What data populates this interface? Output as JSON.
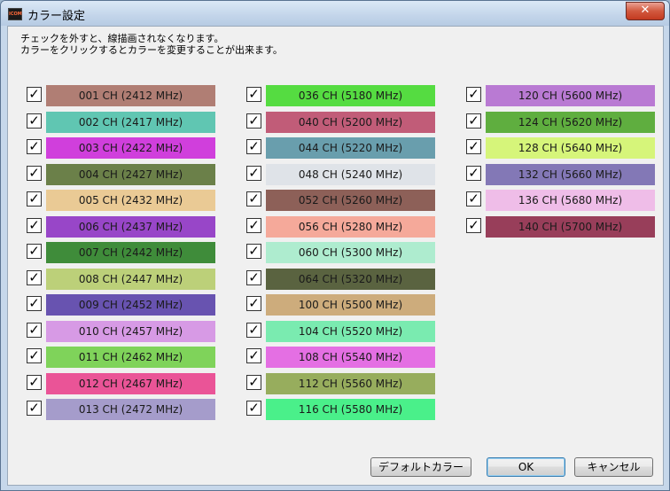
{
  "window": {
    "title": "カラー設定",
    "close_glyph": "✕"
  },
  "info": {
    "line1": "チェックを外すと、線描画されなくなります。",
    "line2": "カラーをクリックするとカラーを変更することが出来ます。"
  },
  "check_glyph": "✓",
  "columns": [
    [
      {
        "label": "001 CH (2412 MHz)",
        "color": "#b07e74"
      },
      {
        "label": "002 CH (2417 MHz)",
        "color": "#60c6b2"
      },
      {
        "label": "003 CH (2422 MHz)",
        "color": "#d03fdc"
      },
      {
        "label": "004 CH (2427 MHz)",
        "color": "#6b8049"
      },
      {
        "label": "005 CH (2432 MHz)",
        "color": "#eaca95"
      },
      {
        "label": "006 CH (2437 MHz)",
        "color": "#9846c8"
      },
      {
        "label": "007 CH (2442 MHz)",
        "color": "#3f8c3a"
      },
      {
        "label": "008 CH (2447 MHz)",
        "color": "#bcd079"
      },
      {
        "label": "009 CH (2452 MHz)",
        "color": "#6853b0"
      },
      {
        "label": "010 CH (2457 MHz)",
        "color": "#d79ae5"
      },
      {
        "label": "011 CH (2462 MHz)",
        "color": "#7fd35a"
      },
      {
        "label": "012 CH (2467 MHz)",
        "color": "#ea5497"
      },
      {
        "label": "013 CH (2472 MHz)",
        "color": "#a59ccb"
      }
    ],
    [
      {
        "label": "036 CH (5180 MHz)",
        "color": "#55dc41"
      },
      {
        "label": "040 CH (5200 MHz)",
        "color": "#c15c78"
      },
      {
        "label": "044 CH (5220 MHz)",
        "color": "#699ead"
      },
      {
        "label": "048 CH (5240 MHz)",
        "color": "#dfe3e8"
      },
      {
        "label": "052 CH (5260 MHz)",
        "color": "#8d6058"
      },
      {
        "label": "056 CH (5280 MHz)",
        "color": "#f5a99a"
      },
      {
        "label": "060 CH (5300 MHz)",
        "color": "#aeeccf"
      },
      {
        "label": "064 CH (5320 MHz)",
        "color": "#5a6340"
      },
      {
        "label": "100 CH (5500 MHz)",
        "color": "#cdac7c"
      },
      {
        "label": "104 CH (5520 MHz)",
        "color": "#7aebb0"
      },
      {
        "label": "108 CH (5540 MHz)",
        "color": "#e46fe3"
      },
      {
        "label": "112 CH (5560 MHz)",
        "color": "#97ad5d"
      },
      {
        "label": "116 CH (5580 MHz)",
        "color": "#4af08a"
      }
    ],
    [
      {
        "label": "120 CH (5600 MHz)",
        "color": "#b97ad3"
      },
      {
        "label": "124 CH (5620 MHz)",
        "color": "#5fae3f"
      },
      {
        "label": "128 CH (5640 MHz)",
        "color": "#d6f57a"
      },
      {
        "label": "132 CH (5660 MHz)",
        "color": "#8378b6"
      },
      {
        "label": "136 CH (5680 MHz)",
        "color": "#efbde8"
      },
      {
        "label": "140 CH (5700 MHz)",
        "color": "#983e5a"
      }
    ]
  ],
  "buttons": {
    "default": "デフォルトカラー",
    "ok": "OK",
    "cancel": "キャンセル"
  }
}
